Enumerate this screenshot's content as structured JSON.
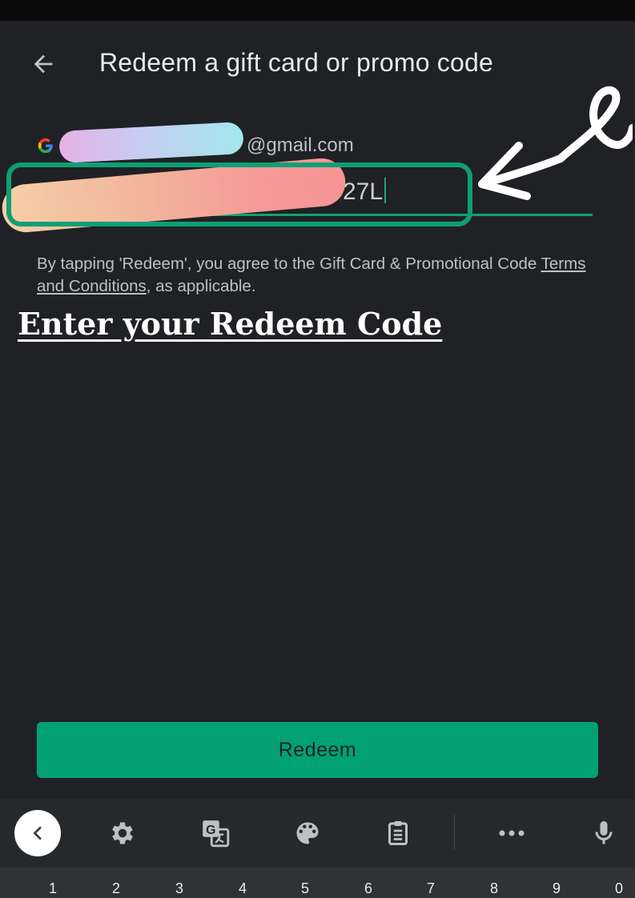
{
  "header": {
    "title": "Redeem a gift card or promo code"
  },
  "account": {
    "email_visible": "@gmail.com"
  },
  "code_input": {
    "value_visible": "C27L"
  },
  "terms": {
    "part1": "By tapping 'Redeem', you agree to the Gift Card & Promotional Code ",
    "link": "Terms and Conditions",
    "part2": ", as applicable."
  },
  "annotation": {
    "heading": "Enter your Redeem Code"
  },
  "redeem_button": {
    "label": "Redeem"
  },
  "keyboard": {
    "toolbar_icons": [
      "chevron-left-icon",
      "gear-icon",
      "translate-icon",
      "palette-icon",
      "clipboard-icon",
      "more-icon",
      "mic-icon"
    ],
    "number_row": [
      "1",
      "2",
      "3",
      "4",
      "5",
      "6",
      "7",
      "8",
      "9",
      "0"
    ]
  },
  "colors": {
    "background": "#202124",
    "accent": "#01a173",
    "highlight": "#0f9f73"
  }
}
